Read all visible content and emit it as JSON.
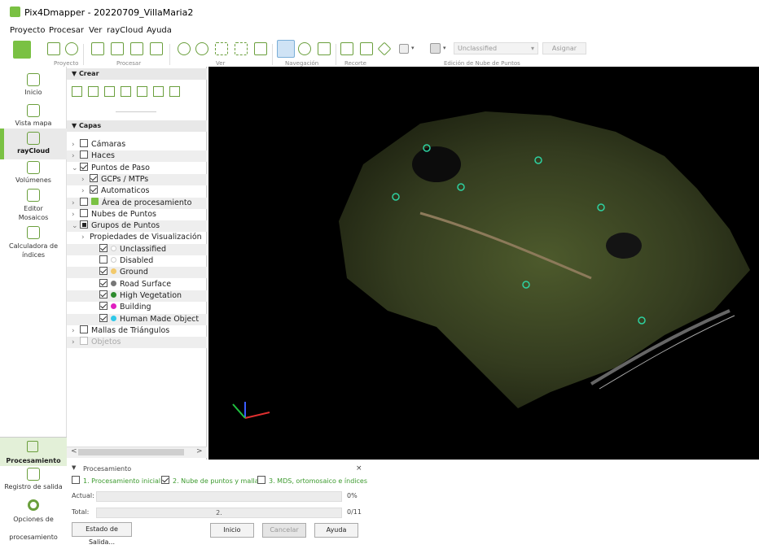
{
  "window": {
    "title": "Pix4Dmapper - 20220709_VillaMaria2"
  },
  "menu": [
    "Proyecto",
    "Procesar",
    "Ver",
    "rayCloud",
    "Ayuda"
  ],
  "toolbar": {
    "groups": [
      "Proyecto",
      "Procesar",
      "Ver",
      "Navegación",
      "Recorte",
      "Edición de Nube de Puntos"
    ],
    "class_select": "Unclassified",
    "assign_button": "Asignar"
  },
  "nav": {
    "inicio": "Inicio",
    "vista_mapa": "Vista mapa",
    "raycloud": "rayCloud",
    "volumenes": "Volúmenes",
    "editor": "Editor Mosaicos",
    "calculadora": "Calculadora de índices",
    "procesamiento": "Procesamiento",
    "registro": "Registro de salida",
    "opciones": "Opciones de procesamiento"
  },
  "panel": {
    "crear": "Crear",
    "capas": "Capas",
    "layers": [
      {
        "label": "Cámaras",
        "indent": 0,
        "arrow": ">",
        "check": "off"
      },
      {
        "label": "Haces",
        "indent": 0,
        "arrow": ">",
        "check": "off"
      },
      {
        "label": "Puntos de Paso",
        "indent": 0,
        "arrow": "v",
        "check": "on"
      },
      {
        "label": "GCPs / MTPs",
        "indent": 1,
        "arrow": ">",
        "check": "on"
      },
      {
        "label": "Automaticos",
        "indent": 1,
        "arrow": ">",
        "check": "on"
      },
      {
        "label": "Área de procesamiento",
        "indent": 0,
        "arrow": ">",
        "check": "off",
        "swatch": "#7ac143"
      },
      {
        "label": "Nubes de Puntos",
        "indent": 0,
        "arrow": ">",
        "check": "off"
      },
      {
        "label": "Grupos de Puntos",
        "indent": 0,
        "arrow": "v",
        "check": "part"
      },
      {
        "label": "Propiedades de Visualización",
        "indent": 1,
        "arrow": ">",
        "check": "none"
      },
      {
        "label": "Unclassified",
        "indent": 2,
        "arrow": "",
        "check": "on",
        "dot": "#ffffff"
      },
      {
        "label": "Disabled",
        "indent": 2,
        "arrow": "",
        "check": "off",
        "dot": "#ffffff"
      },
      {
        "label": "Ground",
        "indent": 2,
        "arrow": "",
        "check": "on",
        "dot": "#f2c96b"
      },
      {
        "label": "Road Surface",
        "indent": 2,
        "arrow": "",
        "check": "on",
        "dot": "#777777"
      },
      {
        "label": "High Vegetation",
        "indent": 2,
        "arrow": "",
        "check": "on",
        "dot": "#2e8b2e"
      },
      {
        "label": "Building",
        "indent": 2,
        "arrow": "",
        "check": "on",
        "dot": "#e020c0"
      },
      {
        "label": "Human Made Object",
        "indent": 2,
        "arrow": "",
        "check": "on",
        "dot": "#30c8e8"
      },
      {
        "label": "Mallas de Triángulos",
        "indent": 0,
        "arrow": ">",
        "check": "off"
      },
      {
        "label": "Objetos",
        "indent": 0,
        "arrow": ">",
        "check": "off",
        "disabled": true
      }
    ]
  },
  "processing": {
    "title": "Procesamiento",
    "close": "×",
    "steps": [
      {
        "label": "1. Procesamiento inicial",
        "checked": false
      },
      {
        "label": "2. Nube de puntos y malla",
        "checked": true
      },
      {
        "label": "3. MDS, ortomosaico e índices",
        "checked": false
      }
    ],
    "actual_label": "Actual:",
    "actual_value": "0%",
    "actual_progress": 0,
    "total_label": "Total:",
    "total_bar_text": "2.",
    "total_value": "0/11",
    "buttons": {
      "estado": "Estado de Salida...",
      "inicio": "Inicio",
      "cancelar": "Cancelar",
      "ayuda": "Ayuda"
    }
  },
  "colors": {
    "accent": "#7ac143",
    "step_text": "#3c9a2e"
  }
}
